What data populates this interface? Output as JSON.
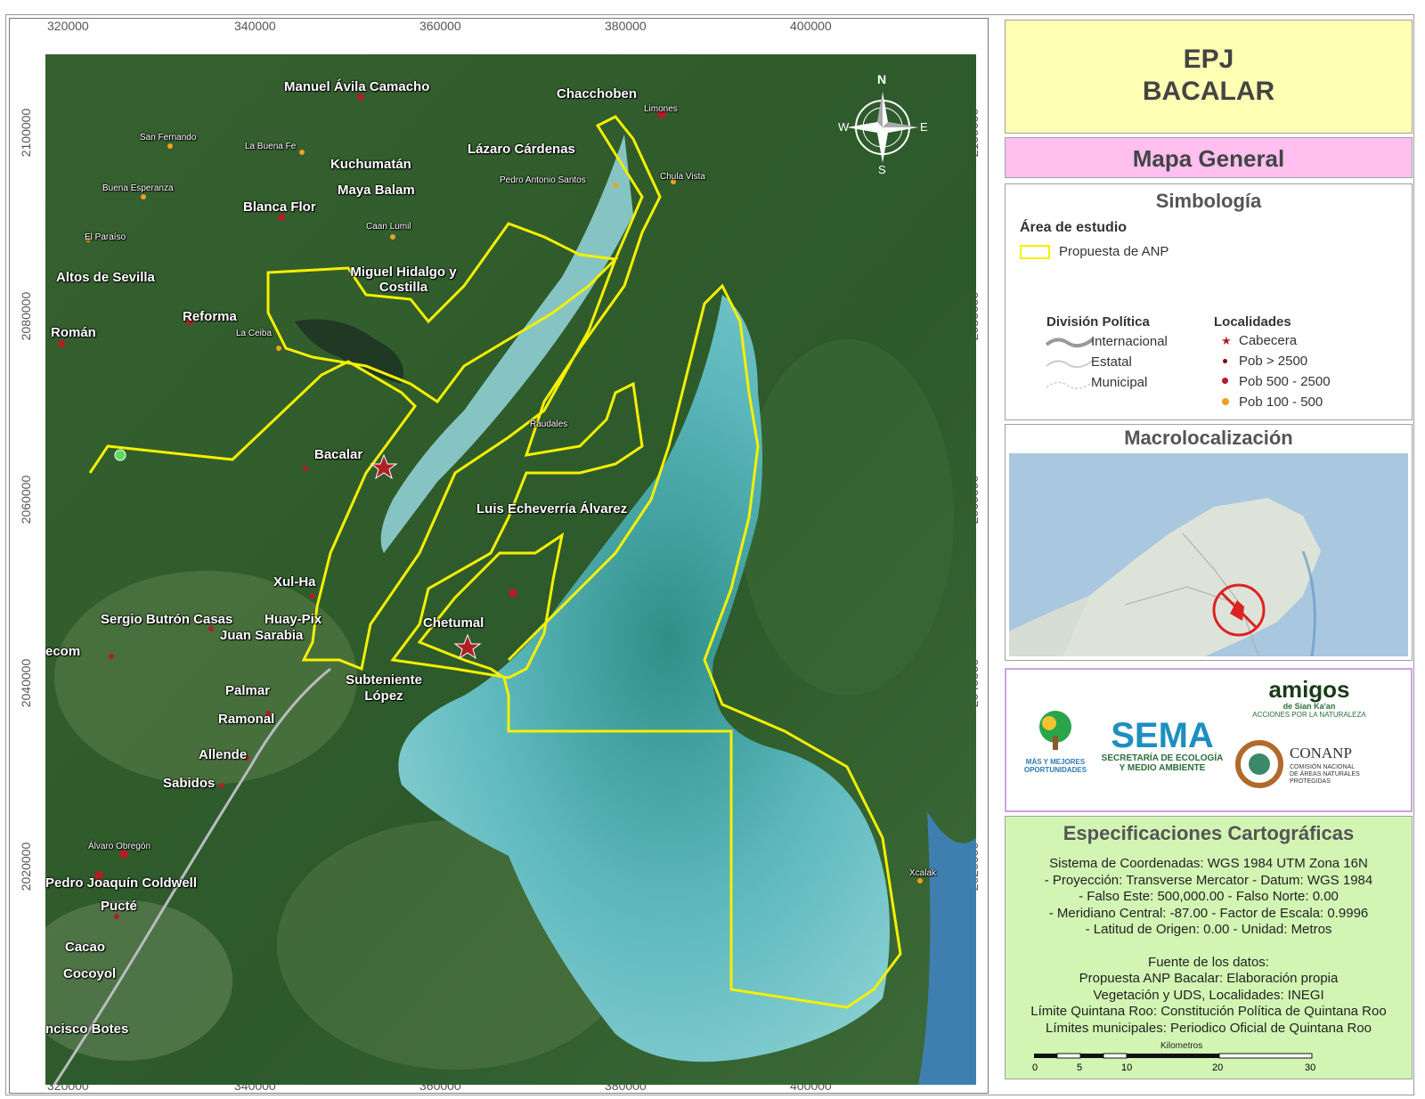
{
  "map": {
    "x_ticks": [
      "320000",
      "340000",
      "360000",
      "380000",
      "400000"
    ],
    "y_ticks": [
      "2100000",
      "2080000",
      "2060000",
      "2040000",
      "2020000"
    ],
    "north_label": "N",
    "south_label": "S",
    "east_label": "E",
    "west_label": "W",
    "places": [
      {
        "name": "Manuel Ávila Camacho",
        "size": "big"
      },
      {
        "name": "Chacchoben",
        "size": "big"
      },
      {
        "name": "Limones",
        "size": "small"
      },
      {
        "name": "Lázaro Cárdenas",
        "size": "big"
      },
      {
        "name": "Kuchumatán",
        "size": "big"
      },
      {
        "name": "Maya Balam",
        "size": "big"
      },
      {
        "name": "Pedro Antonio Santos",
        "size": "small"
      },
      {
        "name": "Chula Vista",
        "size": "small"
      },
      {
        "name": "Blanca Flor",
        "size": "big"
      },
      {
        "name": "San Fernando",
        "size": "small"
      },
      {
        "name": "La Buena Fe",
        "size": "small"
      },
      {
        "name": "Buena Esperanza",
        "size": "small"
      },
      {
        "name": "Caan Lumil",
        "size": "small"
      },
      {
        "name": "El Paraíso",
        "size": "small"
      },
      {
        "name": "Miguel Hidalgo y Costilla",
        "size": "big"
      },
      {
        "name": "Altos de Sevilla",
        "size": "big"
      },
      {
        "name": "Reforma",
        "size": "big"
      },
      {
        "name": "La Ceiba",
        "size": "small"
      },
      {
        "name": "Román",
        "size": "big"
      },
      {
        "name": "Raudales",
        "size": "small"
      },
      {
        "name": "Bacalar",
        "size": "big"
      },
      {
        "name": "Luis Echeverría Álvarez",
        "size": "big"
      },
      {
        "name": "Xul-Ha",
        "size": "big"
      },
      {
        "name": "Sergio Butrón Casas",
        "size": "big"
      },
      {
        "name": "Huay-Pix",
        "size": "big"
      },
      {
        "name": "Juan Sarabia",
        "size": "big"
      },
      {
        "name": "Chetumal",
        "size": "big"
      },
      {
        "name": "ecom",
        "size": "big"
      },
      {
        "name": "Subteniente López",
        "size": "big"
      },
      {
        "name": "Palmar",
        "size": "big"
      },
      {
        "name": "Ramonal",
        "size": "big"
      },
      {
        "name": "Allende",
        "size": "big"
      },
      {
        "name": "Sabidos",
        "size": "big"
      },
      {
        "name": "Álvaro Obregón",
        "size": "small"
      },
      {
        "name": "Pedro Joaquín Coldwell",
        "size": "big"
      },
      {
        "name": "Pucté",
        "size": "big"
      },
      {
        "name": "Cacao",
        "size": "big"
      },
      {
        "name": "Cocoyol",
        "size": "big"
      },
      {
        "name": "ncisco Botes",
        "size": "big"
      },
      {
        "name": "Xcalak",
        "size": "small"
      }
    ]
  },
  "title": {
    "line1": "EPJ",
    "line2": "BACALAR"
  },
  "subtitle": "Mapa General",
  "legend": {
    "heading": "Simbología",
    "study_area_label": "Área de estudio",
    "anp_label": "Propuesta de ANP",
    "politics_heading": "División Política",
    "politics_items": [
      "Internacional",
      "Estatal",
      "Municipal"
    ],
    "localities_heading": "Localidades",
    "localities_items": [
      "Cabecera",
      "Pob > 2500",
      "Pob 500 - 2500",
      "Pob 100 - 500"
    ]
  },
  "macro": {
    "heading": "Macrolocalización"
  },
  "logos": {
    "mas_line1": "MÁS Y MEJORES",
    "mas_line2": "OPORTUNIDADES",
    "sema_name": "SEMA",
    "sema_line1": "SECRETARÍA DE ECOLOGÍA",
    "sema_line2": "Y MEDIO AMBIENTE",
    "amigos_name": "amigos",
    "amigos_sub": "de Sian Ka'an",
    "amigos_tag": "ACCIONES POR LA NATURALEZA",
    "conanp_name": "CONANP",
    "conanp_line1": "COMISIÓN NACIONAL",
    "conanp_line2": "DE ÁREAS NATURALES",
    "conanp_line3": "PROTEGIDAS"
  },
  "spec": {
    "heading": "Especificaciones Cartográficas",
    "lines": [
      "Sistema de Coordenadas: WGS 1984 UTM Zona 16N",
      "- Proyección: Transverse Mercator  - Datum: WGS 1984",
      "- Falso Este: 500,000.00  - Falso Norte: 0.00",
      "- Meridiano Central: -87.00  - Factor de Escala: 0.9996",
      "- Latitud de Origen: 0.00  - Unidad: Metros"
    ],
    "source_lines": [
      "Fuente de los datos:",
      "Propuesta ANP Bacalar: Elaboración propia",
      "Vegetación y UDS, Localidades: INEGI",
      "Límite Quintana Roo: Constitución Política de Quintana Roo",
      "Límites municipales: Periodico Oficial de Quintana Roo"
    ],
    "scale_unit": "Kilometros",
    "scale_ticks": [
      "0",
      "5",
      "10",
      "20",
      "30"
    ]
  },
  "colors": {
    "anp_outline": "#f5f000",
    "forest": "#2f5a2c",
    "lagoon": "#6cc4c8",
    "title_bg": "#ffffb4",
    "subtitle_bg": "#ffc0f0",
    "spec_bg": "#d2f5b4"
  }
}
